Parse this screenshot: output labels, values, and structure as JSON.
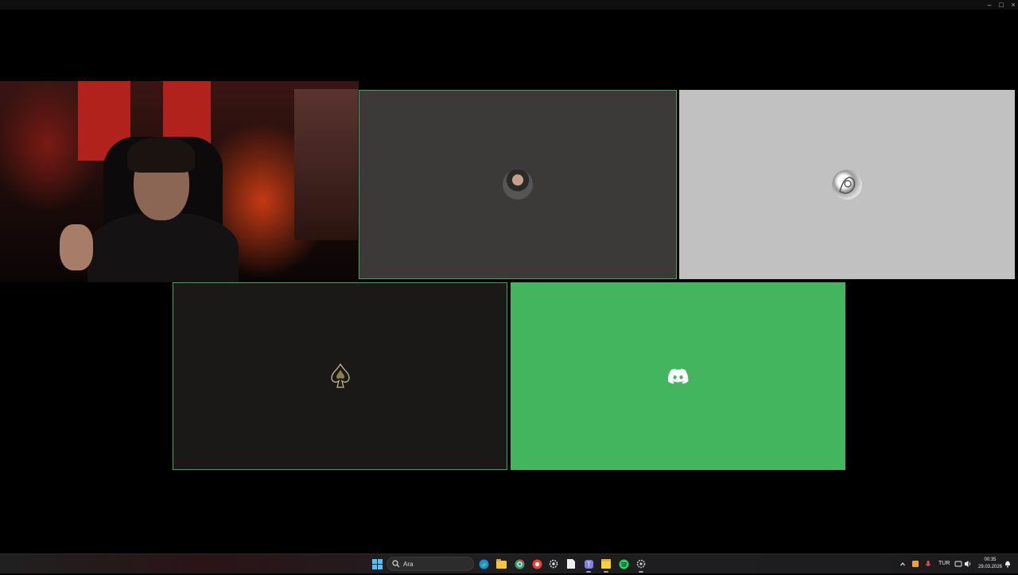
{
  "window": {
    "controls": {
      "minimize": "–",
      "maximize": "□",
      "close": "×"
    }
  },
  "participants": [
    {
      "id": "camera",
      "type": "video",
      "speaking": false
    },
    {
      "id": "user1",
      "type": "avatar",
      "avatar_icon": "photo-avatar-icon",
      "tile_color": "#3b3a39",
      "speaking": true
    },
    {
      "id": "user2",
      "type": "avatar",
      "avatar_icon": "sketch-avatar-icon",
      "tile_color": "#c1c1c1",
      "speaking": false
    },
    {
      "id": "user3",
      "type": "avatar",
      "avatar_icon": "spade-avatar-icon",
      "tile_color": "#1a1918",
      "speaking": true
    },
    {
      "id": "user4",
      "type": "avatar",
      "avatar_icon": "discord-logo-icon",
      "tile_color": "#43b55f",
      "speaking": false
    }
  ],
  "colors": {
    "speaking_border": "#3ba55d",
    "discord_green": "#43b55f",
    "background": "#000000"
  },
  "taskbar": {
    "search_placeholder": "Ara",
    "apps": [
      "start-icon",
      "edge-icon",
      "file-explorer-icon",
      "chrome-icon",
      "chrome-alt-icon",
      "settings-icon",
      "file-icon",
      "teams-icon",
      "sticky-notes-icon",
      "spotify-icon",
      "gear-icon"
    ],
    "tray": {
      "language": "TUR",
      "time": "00:35",
      "date": "29.03.2026"
    }
  }
}
